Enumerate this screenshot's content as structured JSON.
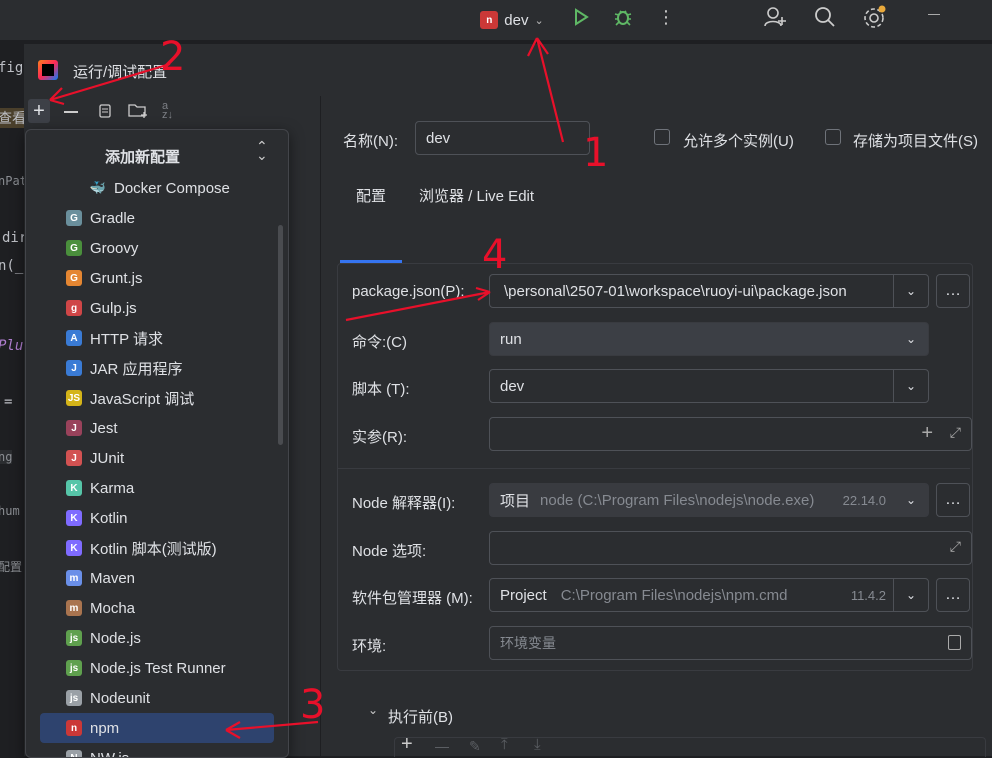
{
  "toolbar": {
    "run_config": "dev",
    "icons": [
      "npm-icon",
      "chevron-down-icon",
      "run-icon",
      "debug-icon",
      "more-icon",
      "add-user-icon",
      "search-icon",
      "settings-icon",
      "minimize-icon"
    ]
  },
  "editor_strip": {
    "snippets": [
      "fig.j",
      "查看",
      "nPat",
      "dir",
      "n(_",
      "Plu",
      "=",
      "ng",
      "hum",
      "配置"
    ]
  },
  "dialog": {
    "title": "运行/调试配置",
    "left_toolbar": [
      "add-icon",
      "remove-icon",
      "copy-icon",
      "new-folder-icon",
      "sort-icon"
    ]
  },
  "popup": {
    "title": "添加新配置",
    "items": [
      {
        "label": "Docker Compose",
        "icon": "docker-icon",
        "color": "#2496ed"
      },
      {
        "label": "Gradle",
        "icon": "gradle-icon",
        "color": "#6a8f9c"
      },
      {
        "label": "Groovy",
        "icon": "groovy-icon",
        "color": "#4a8f3c"
      },
      {
        "label": "Grunt.js",
        "icon": "grunt-icon",
        "color": "#e48632"
      },
      {
        "label": "Gulp.js",
        "icon": "gulp-icon",
        "color": "#cf4647"
      },
      {
        "label": "HTTP 请求",
        "icon": "http-icon",
        "color": "#3a7bd5"
      },
      {
        "label": "JAR 应用程序",
        "icon": "jar-icon",
        "color": "#3a7bd5"
      },
      {
        "label": "JavaScript 调试",
        "icon": "javascript-icon",
        "color": "#d4b419"
      },
      {
        "label": "Jest",
        "icon": "jest-icon",
        "color": "#99425b"
      },
      {
        "label": "JUnit",
        "icon": "junit-icon",
        "color": "#d25252"
      },
      {
        "label": "Karma",
        "icon": "karma-icon",
        "color": "#56c5a8"
      },
      {
        "label": "Kotlin",
        "icon": "kotlin-icon",
        "color": "#7f6bff"
      },
      {
        "label": "Kotlin 脚本(测试版)",
        "icon": "kotlin-script-icon",
        "color": "#7f6bff"
      },
      {
        "label": "Maven",
        "icon": "maven-icon",
        "color": "#6a8fe8"
      },
      {
        "label": "Mocha",
        "icon": "mocha-icon",
        "color": "#a9744f"
      },
      {
        "label": "Node.js",
        "icon": "nodejs-icon",
        "color": "#5fa04e"
      },
      {
        "label": "Node.js Test Runner",
        "icon": "nodejs-test-icon",
        "color": "#5fa04e"
      },
      {
        "label": "Nodeunit",
        "icon": "nodeunit-icon",
        "color": "#9aa0a6"
      },
      {
        "label": "npm",
        "icon": "npm-icon",
        "color": "#cb3837"
      },
      {
        "label": "NW.js",
        "icon": "nwjs-icon",
        "color": "#9aa0a6"
      }
    ]
  },
  "form": {
    "name_label": "名称(N):",
    "name_value": "dev",
    "allow_multiple": "允许多个实例(U)",
    "store_as_file": "存储为项目文件(S)",
    "tabs": [
      "配置",
      "浏览器 / Live Edit"
    ],
    "package_json_label": "package.json(P):",
    "package_json_value": "\\personal\\2507-01\\workspace\\ruoyi-ui\\package.json",
    "command_label": "命令:(C)",
    "command_value": "run",
    "script_label": "脚本 (T):",
    "script_value": "dev",
    "args_label": "实参(R):",
    "node_interp_label": "Node 解释器(I):",
    "node_interp_prefix": "项目",
    "node_interp_path": "node (C:\\Program Files\\nodejs\\node.exe)",
    "node_interp_version": "22.14.0",
    "node_options_label": "Node 选项:",
    "pkg_manager_label": "软件包管理器 (M):",
    "pkg_manager_prefix": "Project",
    "pkg_manager_path": "C:\\Program Files\\nodejs\\npm.cmd",
    "pkg_manager_version": "11.4.2",
    "env_label": "环境:",
    "env_placeholder": "环境变量",
    "before_launch": "执行前(B)"
  },
  "annotations": [
    "1",
    "2",
    "3",
    "4"
  ]
}
